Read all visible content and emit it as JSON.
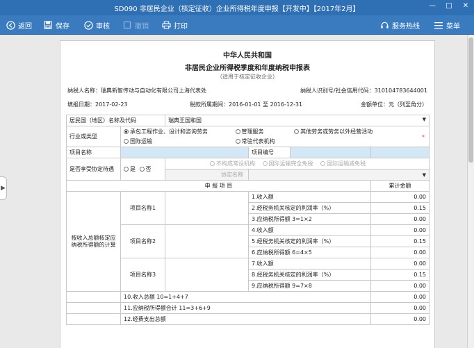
{
  "window": {
    "title": "SD090 非居民企业（核定征收）企业所得税年度申报【开发中】【2017年2月】",
    "controls": [
      "—",
      "□",
      "✕"
    ]
  },
  "toolbar": {
    "back": "返回",
    "save": "保存",
    "review": "审核",
    "disabled_btn": "撤销",
    "print": "打印",
    "hotline": "服务热线",
    "menu": "菜单"
  },
  "doc": {
    "title1": "中华人民共和国",
    "title2": "非居民企业所得税季度和年度纳税申报表",
    "subtitle": "（适用于核定征收企业）",
    "taxpayer_name_label": "纳税人名称：",
    "taxpayer_name": "瑞典新智传动与自动化有限公司上海代表处",
    "taxpayer_id_label": "纳税人识别号/社会信用代码：",
    "taxpayer_id": "310104783644001",
    "fill_date_label": "填报日期：",
    "fill_date": "2017-02-23",
    "period_label": "税款所属期间：",
    "period_from": "2016-01-01",
    "period_to_word": "至",
    "period_to": "2016-12-31",
    "unit_label": "金额单位：",
    "unit": "元（列至角分）"
  },
  "form": {
    "residence_label": "居民国（地区）名称及代码",
    "residence_value": "瑞典王国和国",
    "industry_label": "行业或类型",
    "industry_options": [
      {
        "label": "承包工程作业、设计和咨询劳务",
        "checked": true
      },
      {
        "label": "管理服务",
        "checked": false
      },
      {
        "label": "其他劳务或劳务以外经营活动",
        "checked": false
      },
      {
        "label": "国际运输",
        "checked": false
      },
      {
        "label": "常驻代表机构",
        "checked": false
      }
    ],
    "required_mark": "*",
    "project_name_label": "项目名称",
    "project_no_label": "项目编号",
    "treaty_label": "是否享受协定待遇",
    "treaty_yes": "是",
    "treaty_no": "否",
    "treaty_sub_options": [
      "不构成常设机构",
      "国际运输完全免税",
      "国际运输减免税"
    ],
    "treaty_name_label": "协定名称",
    "header_items": "申 报 项 目",
    "header_total": "累计金额",
    "group_label": "按收入总额核定应纳税所得额的计算",
    "projects": [
      {
        "name_label": "项目名称1",
        "lines": [
          {
            "label": "1.收入额",
            "amount": "0.00"
          },
          {
            "label": "2.经税务机关核定的利润率（%）",
            "amount": "0.15"
          },
          {
            "label": "3.应纳税所得额  3=1×2",
            "amount": "0.00"
          }
        ]
      },
      {
        "name_label": "项目名称2",
        "lines": [
          {
            "label": "4.收入额",
            "amount": "0.00"
          },
          {
            "label": "5.经税务机关核定的利润率（%）",
            "amount": "0.15"
          },
          {
            "label": "6.应纳税所得额  6=4×5",
            "amount": "0.00"
          }
        ]
      },
      {
        "name_label": "项目名称3",
        "lines": [
          {
            "label": "7.收入额",
            "amount": "0.00"
          },
          {
            "label": "8.经税务机关核定的利润率（%）",
            "amount": "0.15"
          },
          {
            "label": "9.应纳税所得额  9=7×8",
            "amount": "0.00"
          }
        ]
      }
    ],
    "total_lines": [
      {
        "label": "10.收入总额  10=1+4+7",
        "amount": "0.00"
      },
      {
        "label": "11.应纳税所得额合计  11=3+6+9",
        "amount": "0.00"
      },
      {
        "label": "12.经费支出总额",
        "amount": "0.00"
      }
    ]
  }
}
